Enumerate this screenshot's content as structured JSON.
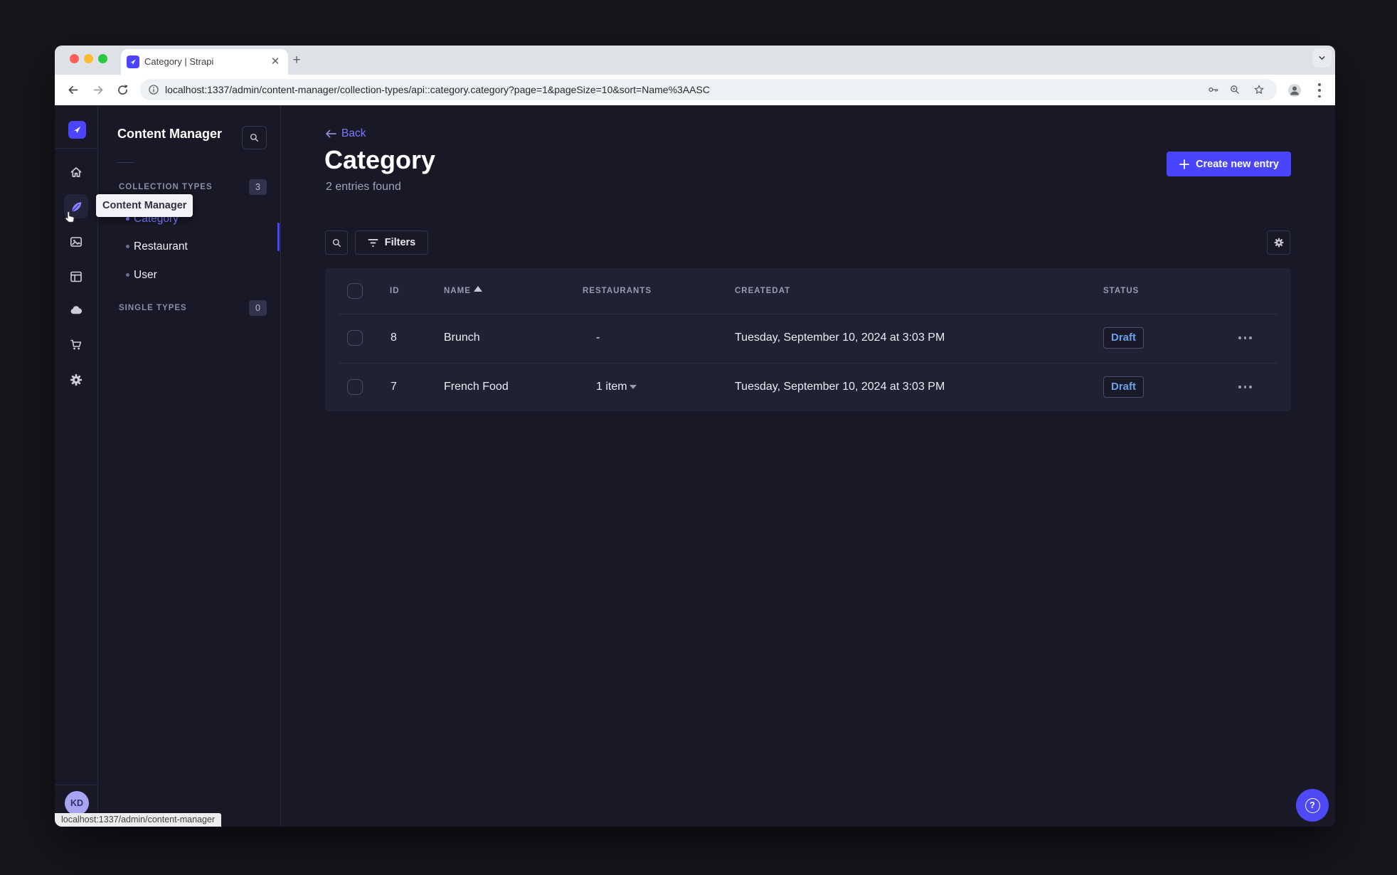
{
  "browser": {
    "tab_title": "Category | Strapi",
    "url": "localhost:1337/admin/content-manager/collection-types/api::category.category?page=1&pageSize=10&sort=Name%3AASC",
    "status_bar": "localhost:1337/admin/content-manager"
  },
  "sidebar": {
    "tooltip": "Content Manager",
    "avatar_initials": "KD"
  },
  "subnav": {
    "title": "Content Manager",
    "sections": [
      {
        "label": "COLLECTION TYPES",
        "count": "3",
        "items": [
          {
            "label": "Category"
          },
          {
            "label": "Restaurant"
          },
          {
            "label": "User"
          }
        ]
      },
      {
        "label": "SINGLE TYPES",
        "count": "0",
        "items": []
      }
    ],
    "active_item": "Category"
  },
  "main": {
    "back_label": "Back",
    "title": "Category",
    "subtitle": "2 entries found",
    "create_button": "Create new entry",
    "filters_button": "Filters",
    "table": {
      "headers": {
        "id": "ID",
        "name": "NAME",
        "restaurants": "RESTAURANTS",
        "createdat": "CREATEDAT",
        "status": "STATUS"
      },
      "sort": "name-ascending",
      "rows": [
        {
          "id": "8",
          "name": "Brunch",
          "restaurants": "-",
          "createdat": "Tuesday, September 10, 2024 at 3:03 PM",
          "status": "Draft"
        },
        {
          "id": "7",
          "name": "French Food",
          "restaurants": "1 item",
          "createdat": "Tuesday, September 10, 2024 at 3:03 PM",
          "status": "Draft"
        }
      ]
    }
  },
  "colors": {
    "primary": "#4945ff",
    "primary_light": "#7b79ff",
    "draft_text": "#67a1e9",
    "app_bg": "#181826",
    "panel_bg": "#212134"
  }
}
